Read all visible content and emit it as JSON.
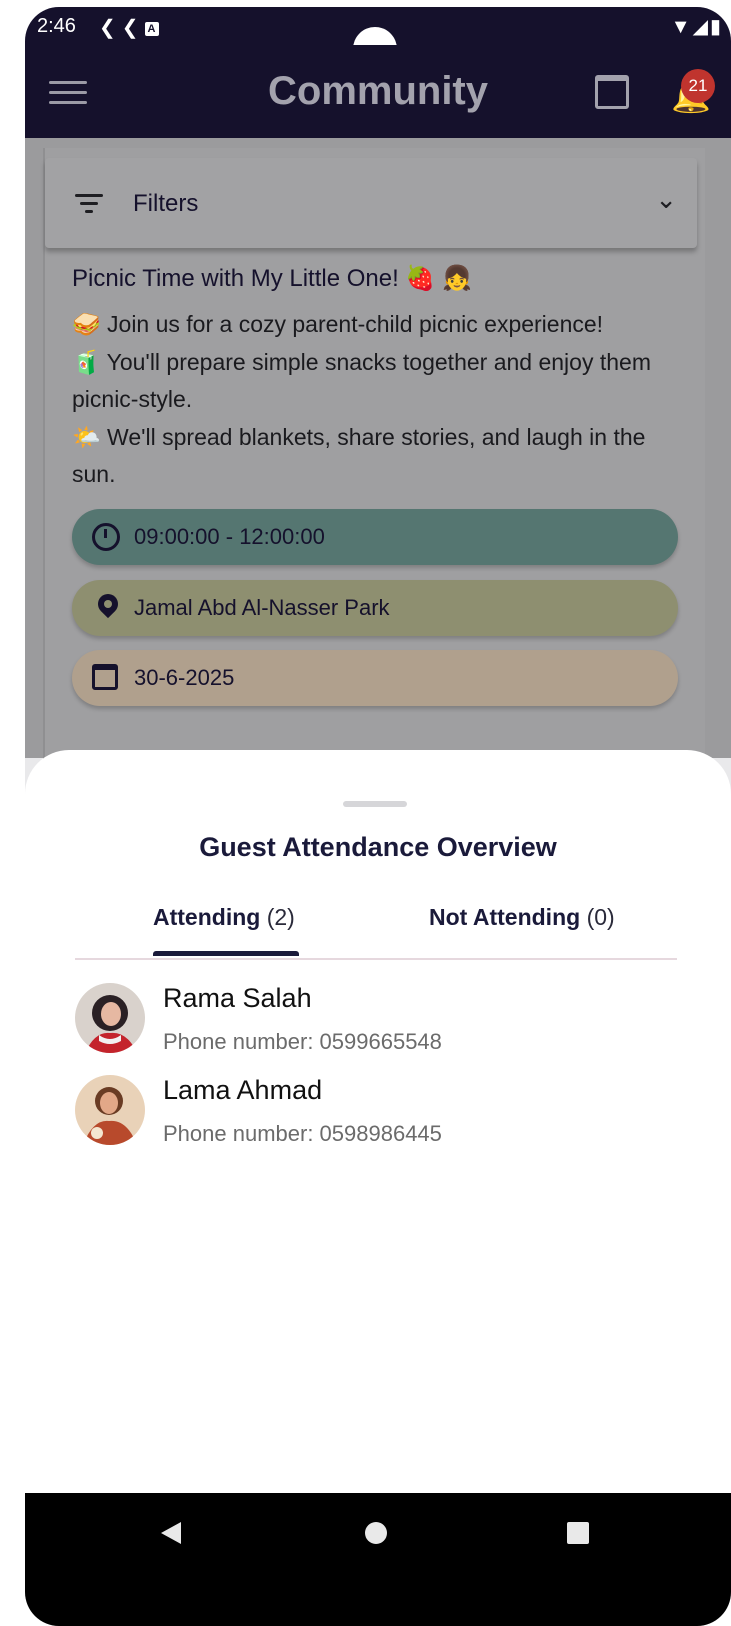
{
  "status_bar": {
    "time": "2:46",
    "notification_icons": [
      "flutter-icon",
      "flutter-icon",
      "a-box-icon"
    ],
    "right_icons": [
      "wifi-icon",
      "signal-icon",
      "battery-icon"
    ]
  },
  "app_bar": {
    "title": "Community",
    "notification_count": "21"
  },
  "filters": {
    "label": "Filters"
  },
  "post": {
    "title": "Picnic Time with My Little One! 🍓 👧",
    "line1": "🥪 Join us for a cozy parent-child picnic experience!",
    "line2": "🧃 You'll prepare simple snacks together and enjoy them picnic-style.",
    "line3": "🌤️ We'll spread blankets, share stories, and laugh in the sun.",
    "time": "09:00:00 - 12:00:00",
    "location": "Jamal Abd Al-Nasser Park",
    "date": "30-6-2025",
    "colors": {
      "time_pill": "#557671",
      "location_pill": "#8e8f70",
      "date_pill": "#b0a08d"
    }
  },
  "sheet": {
    "title": "Guest Attendance Overview",
    "tabs": [
      {
        "label": "Attending",
        "count": "(2)",
        "selected": true
      },
      {
        "label": "Not Attending",
        "count": "(0)",
        "selected": false
      }
    ],
    "guests": [
      {
        "name": "Rama Salah",
        "phone": "Phone number: 0599665548"
      },
      {
        "name": "Lama Ahmad",
        "phone": "Phone number: 0598986445"
      }
    ]
  },
  "theme": {
    "appbar_bg": "#15112c",
    "accent": "#1a1a3a",
    "badge": "#c0342e"
  }
}
